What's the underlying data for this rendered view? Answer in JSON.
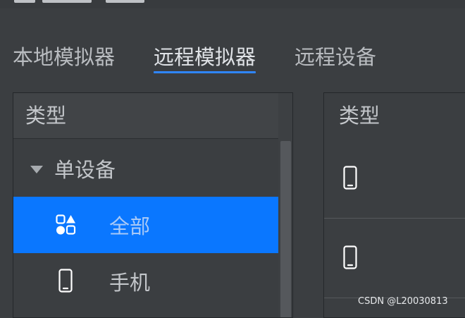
{
  "tabs": [
    {
      "label": "本地模拟器",
      "active": false
    },
    {
      "label": "远程模拟器",
      "active": true
    },
    {
      "label": "远程设备",
      "active": false
    }
  ],
  "left_panel": {
    "header": "类型",
    "group_label": "单设备",
    "items": [
      {
        "label": "全部",
        "icon": "all-categories-icon",
        "selected": true
      },
      {
        "label": "手机",
        "icon": "phone-icon",
        "selected": false
      }
    ]
  },
  "right_panel": {
    "header": "类型",
    "rows": [
      {
        "icon": "phone-icon"
      },
      {
        "icon": "phone-icon"
      }
    ]
  },
  "colors": {
    "accent": "#0a77ff",
    "underline": "#2f86ff",
    "background": "#3b3e41"
  },
  "watermark": "CSDN @L20030813"
}
